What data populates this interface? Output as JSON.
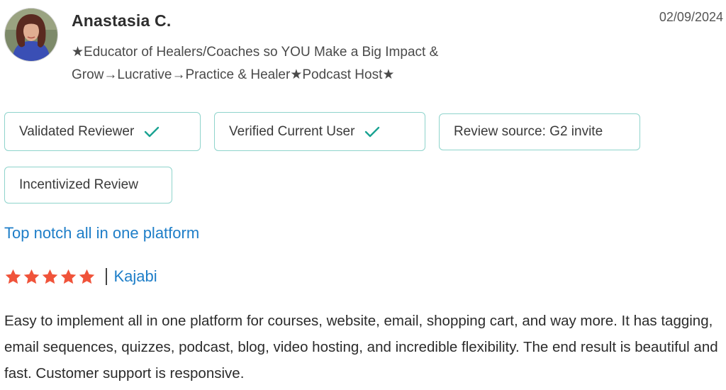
{
  "reviewer": {
    "name": "Anastasia C.",
    "title": "★Educator of Healers/Coaches so YOU Make a Big Impact & Grow→Lucrative→Practice & Healer★Podcast Host★",
    "avatar_icon": "person-photo"
  },
  "review_date": "02/09/2024",
  "badges": [
    {
      "label": "Validated Reviewer",
      "icon": "check-icon"
    },
    {
      "label": "Verified Current User",
      "icon": "check-icon"
    },
    {
      "label": "Review source: G2 invite"
    },
    {
      "label": "Incentivized Review"
    }
  ],
  "review": {
    "title": "Top notch all in one platform",
    "rating": 5,
    "rating_max": 5,
    "separator": "|",
    "product": "Kajabi",
    "body": "Easy to implement all in one platform for courses, website, email, shopping cart, and way more. It has tagging, email sequences, quizzes, podcast, blog, video hosting, and incredible flexibility. The end result is beautiful and fast. Customer support is responsive."
  },
  "colors": {
    "link": "#1e7ec8",
    "star": "#f0533a",
    "badge_border": "#8fd4cc",
    "check": "#1aa392"
  }
}
